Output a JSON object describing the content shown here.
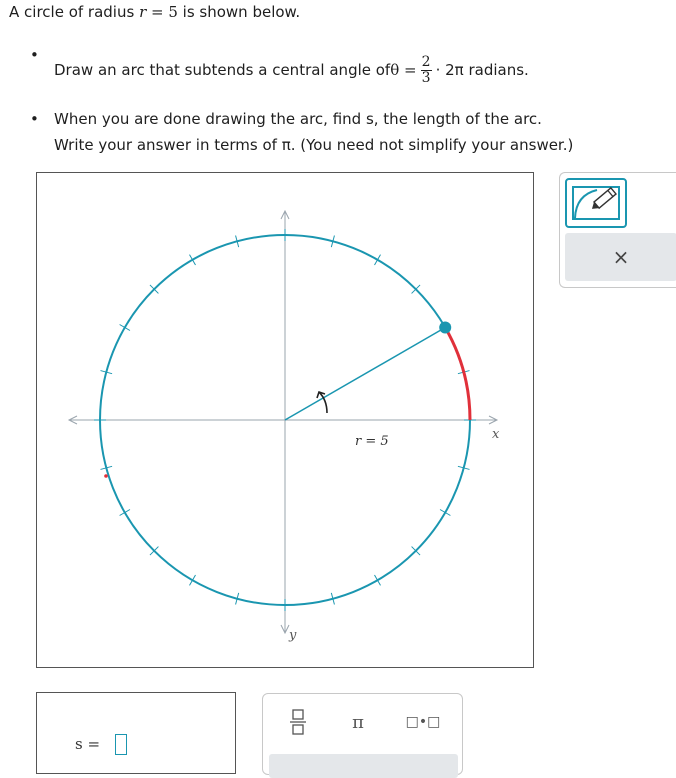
{
  "prompt": {
    "intro_prefix": "A circle of radius ",
    "intro_var": "r",
    "intro_eq": " = 5",
    "intro_suffix": " is shown below."
  },
  "tasks": {
    "t1_prefix": "Draw an arc that subtends a central angle of ",
    "t1_theta": "θ =",
    "t1_frac_num": "2",
    "t1_frac_den": "3",
    "t1_suffix": "· 2π radians.",
    "t2_line1": "When you are done drawing the arc, find s, the length of the arc.",
    "t2_line2": "Write your answer in terms of π. (You need not simplify your answer.)"
  },
  "graph": {
    "x_axis_label": "x",
    "y_axis_label": "y",
    "radius_label": "r = 5",
    "radius": 5,
    "tick_count": 24,
    "arc_endpoint_angle_deg": 30,
    "colors": {
      "circle": "#1a96b0",
      "arc": "#e0303a",
      "axes": "#9aa4ad",
      "radius_line": "#1a96b0"
    }
  },
  "tools": {
    "draw_tool_icon": "pencil-arc-icon",
    "clear_label": "×"
  },
  "answer": {
    "label": "s ="
  },
  "keypad": {
    "fraction_icon": "fraction-icon",
    "pi_label": "π",
    "multiply_label": "□•□"
  }
}
